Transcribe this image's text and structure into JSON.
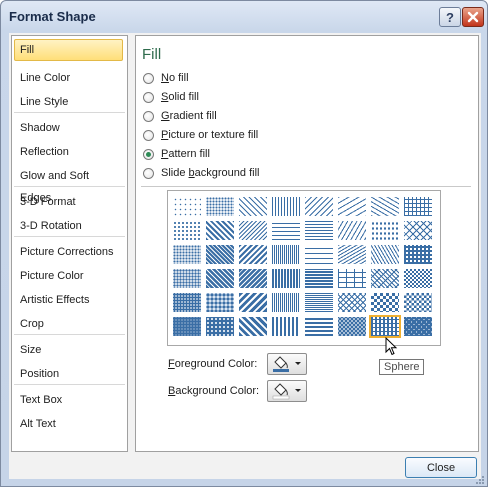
{
  "window": {
    "title": "Format Shape",
    "help_label": "?",
    "close_button_label": "Close"
  },
  "nav": {
    "items": [
      {
        "label": "Fill",
        "selected": true
      },
      {
        "label": "Line Color"
      },
      {
        "label": "Line Style"
      },
      {
        "label": "Shadow"
      },
      {
        "label": "Reflection"
      },
      {
        "label": "Glow and Soft Edges"
      },
      {
        "label": "3-D Format"
      },
      {
        "label": "3-D Rotation"
      },
      {
        "label": "Picture Corrections"
      },
      {
        "label": "Picture Color"
      },
      {
        "label": "Artistic Effects"
      },
      {
        "label": "Crop"
      },
      {
        "label": "Size"
      },
      {
        "label": "Position"
      },
      {
        "label": "Text Box"
      },
      {
        "label": "Alt Text"
      }
    ]
  },
  "fill": {
    "title": "Fill",
    "options": [
      {
        "label": "No fill",
        "accel": "N",
        "rest": "o fill",
        "checked": false
      },
      {
        "label": "Solid fill",
        "accel": "S",
        "rest": "olid fill",
        "checked": false
      },
      {
        "label": "Gradient fill",
        "accel": "G",
        "rest": "radient fill",
        "checked": false
      },
      {
        "label": "Picture or texture fill",
        "accel": "P",
        "rest": "icture or texture fill",
        "checked": false
      },
      {
        "label": "Pattern fill",
        "accel": "P",
        "rest": "attern fill",
        "checked": true
      },
      {
        "label": "Slide background fill",
        "pre": "Slide ",
        "accel": "b",
        "rest": "ackground fill",
        "checked": false
      }
    ],
    "pattern_grid": {
      "rows": 6,
      "cols": 8,
      "selected_row": 5,
      "selected_col": 6,
      "pattern_color": "#3a6ea5"
    },
    "foreground_color_label": "Foreground Color:",
    "foreground_accel": "F",
    "foreground_rest": "oreground Color:",
    "background_color_label": "Background Color:",
    "background_accel": "B",
    "background_rest": "ackground Color:",
    "foreground_swatch": "#3a6ea5",
    "background_swatch": "#ffffff",
    "tooltip": "Sphere"
  },
  "colors": {
    "title_bar_text": "#1a2c4a",
    "selected_nav": "#ffdf79",
    "accent_green": "#2e6b4c"
  }
}
